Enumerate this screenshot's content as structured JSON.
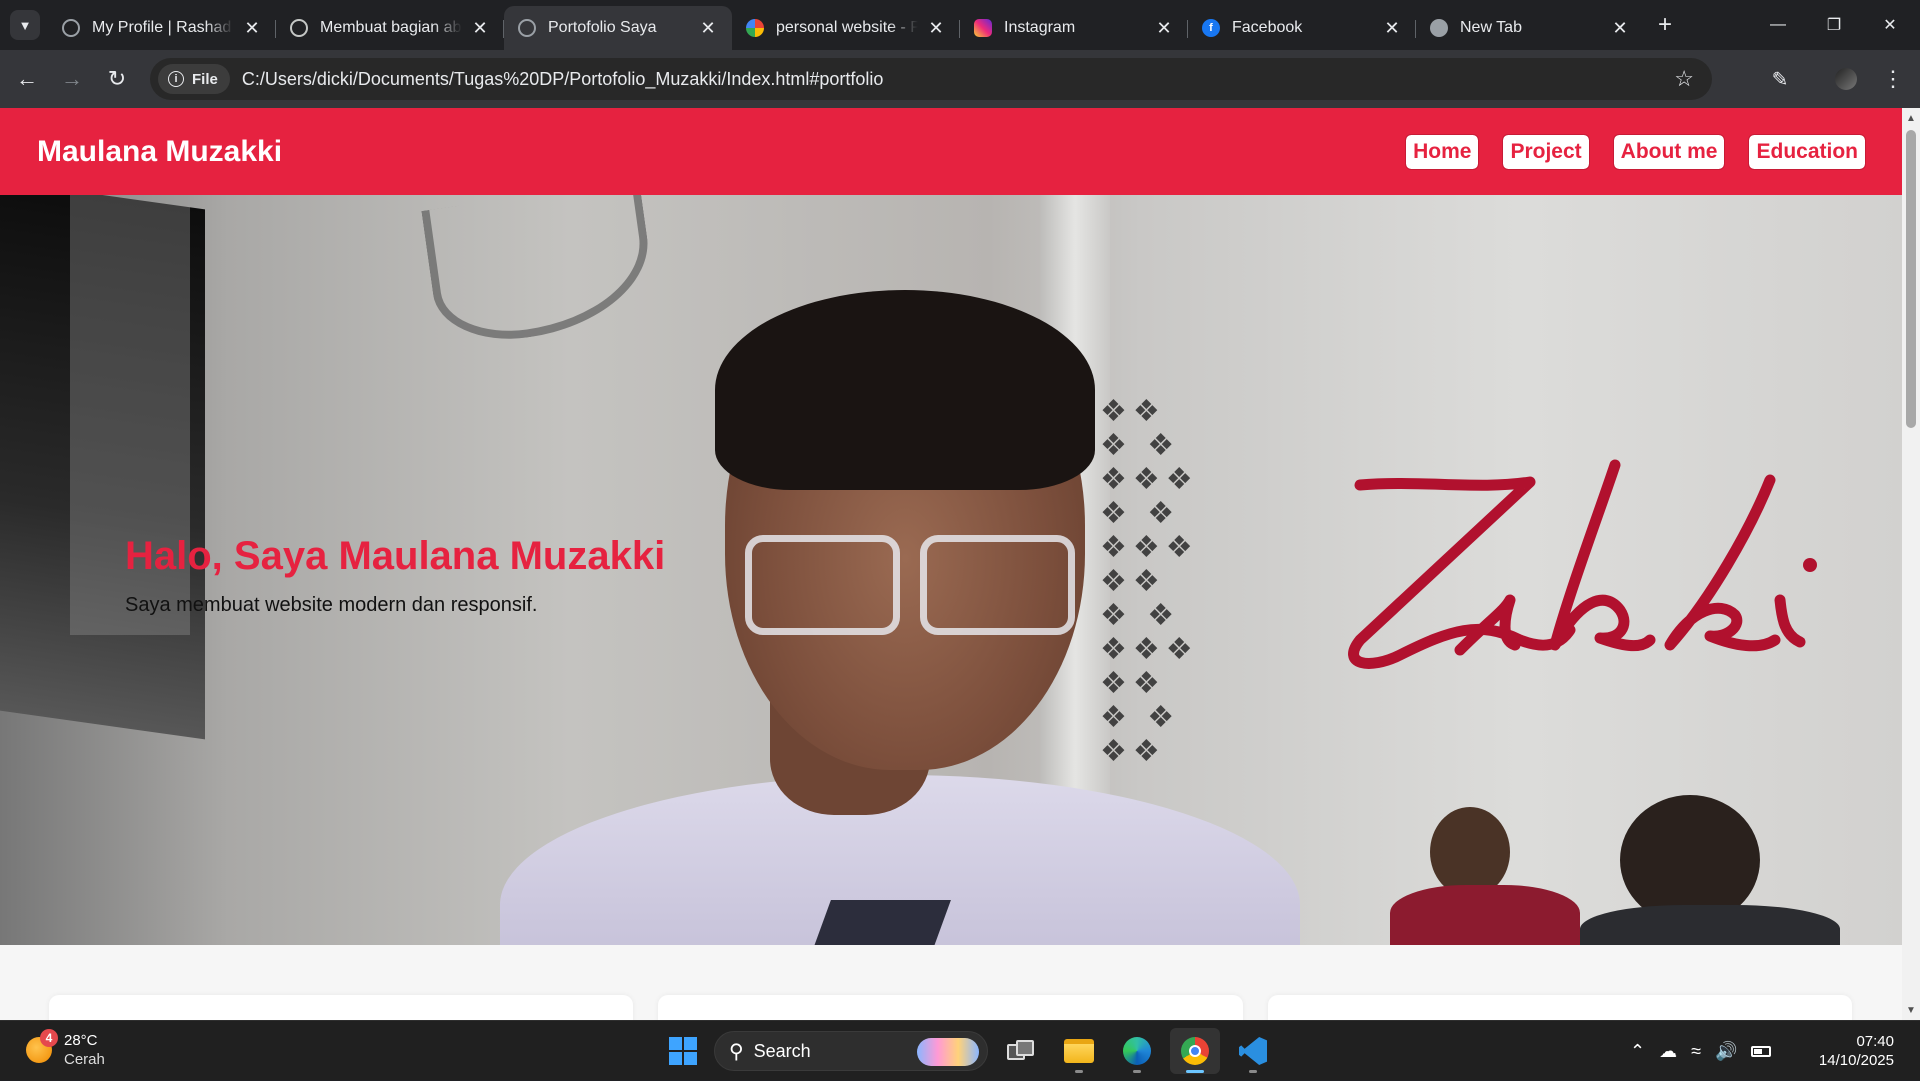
{
  "browser": {
    "tabs": [
      {
        "title": "My Profile | Rashad F",
        "favicon": "globe-icon",
        "active": false
      },
      {
        "title": "Membuat bagian abo",
        "favicon": "chatgpt-icon",
        "active": false
      },
      {
        "title": "Portofolio Saya",
        "favicon": "globe-icon",
        "active": true
      },
      {
        "title": "personal website - Pa",
        "favicon": "google-icon",
        "active": false
      },
      {
        "title": "Instagram",
        "favicon": "instagram-icon",
        "active": false
      },
      {
        "title": "Facebook",
        "favicon": "facebook-icon",
        "active": false
      },
      {
        "title": "New Tab",
        "favicon": "chrome-icon",
        "active": false
      }
    ],
    "chip_label": "File",
    "url": "C:/Users/dicki/Documents/Tugas%20DP/Portofolio_Muzakki/Index.html#portfolio"
  },
  "page": {
    "brand": "Maulana Muzakki",
    "nav": [
      "Home",
      "Project",
      "About me",
      "Education"
    ],
    "hero": {
      "title": "Halo, Saya Maulana Muzakki",
      "subtitle": "Saya membuat website modern dan responsif.",
      "signature": "Zakki"
    },
    "accent_color": "#e62240"
  },
  "taskbar": {
    "weather": {
      "temp": "28°C",
      "condition": "Cerah",
      "badge": "4"
    },
    "search_label": "Search",
    "time": "07:40",
    "date": "14/10/2025"
  }
}
